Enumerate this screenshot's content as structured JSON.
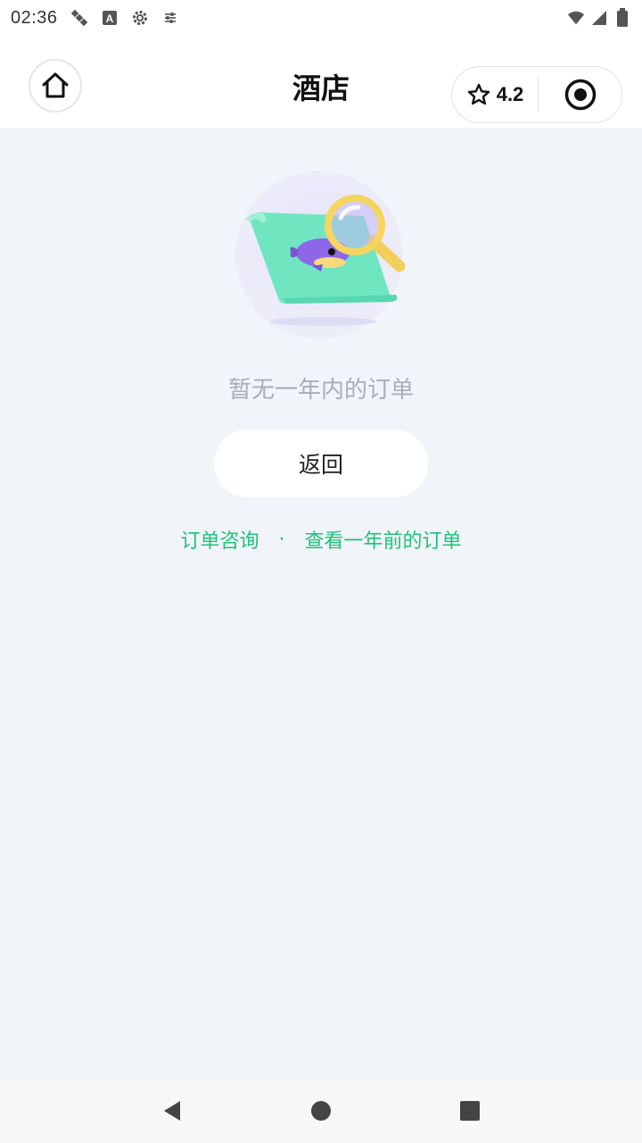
{
  "status_bar": {
    "time": "02:36",
    "left_icons": [
      "satellite-icon",
      "a-badge-icon",
      "settings-gear-icon",
      "sliders-icon"
    ],
    "right_icons": [
      "wifi-icon",
      "cellular-signal-icon",
      "battery-icon"
    ]
  },
  "nav": {
    "title": "酒店",
    "home_icon": "home-icon",
    "rating": "4.2",
    "rating_icon": "star-outline-icon",
    "menu_icon": "target-record-icon"
  },
  "empty_state": {
    "illustration": "search-scroll-whale-illustration",
    "message": "暂无一年内的订单",
    "back_button": "返回"
  },
  "links": {
    "consult": "订单咨询",
    "separator": "·",
    "older_orders": "查看一年前的订单"
  },
  "colors": {
    "accent_green": "#1fc27a",
    "background": "#f1f4f8",
    "muted_text": "#a9aeb6"
  },
  "system_nav": [
    "back-triangle-icon",
    "home-circle-icon",
    "recents-square-icon"
  ]
}
